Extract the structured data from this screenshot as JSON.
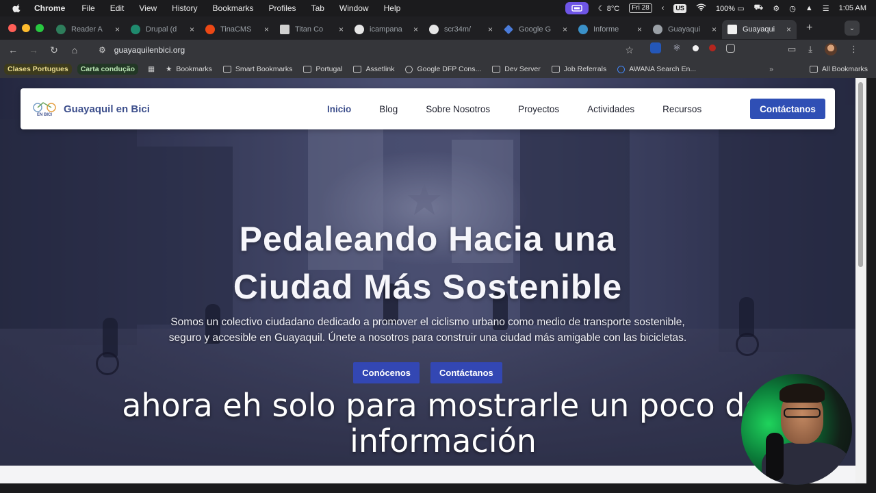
{
  "menubar": {
    "app": "Chrome",
    "items": [
      "File",
      "Edit",
      "View",
      "History",
      "Bookmarks",
      "Profiles",
      "Tab",
      "Window",
      "Help"
    ],
    "weather": "8°C",
    "date": "Fri 28",
    "input_source": "US",
    "battery": "100%",
    "time": "1:05 AM"
  },
  "tabs": [
    {
      "label": "Reader A",
      "color": "#2e7d5b"
    },
    {
      "label": "Drupal (d",
      "color": "#1f8a6e"
    },
    {
      "label": "TinaCMS",
      "color": "#ec4815"
    },
    {
      "label": "Titan Co",
      "color": "#d0d0d0"
    },
    {
      "label": "icampana",
      "color": "#e6e6e6"
    },
    {
      "label": "scr34m/",
      "color": "#e6e6e6"
    },
    {
      "label": "Google G",
      "color": "#4a7bd9"
    },
    {
      "label": "Informe",
      "color": "#3a91c9"
    },
    {
      "label": "Guayaqui",
      "color": "#9aa0a6"
    },
    {
      "label": "Guayaqui",
      "color": "#f0f0f0"
    }
  ],
  "omnibox": {
    "url": "guayaquilenbici.org"
  },
  "bookmarks": {
    "chips": [
      "Clases Portugues",
      "Carta condução"
    ],
    "items": [
      "Bookmarks",
      "Smart Bookmarks",
      "Portugal",
      "Assetlink",
      "Google DFP Cons...",
      "Dev Server",
      "Job Referrals",
      "AWANA Search En..."
    ],
    "more": "»",
    "all": "All Bookmarks"
  },
  "site": {
    "logo_text": "EN BICI",
    "brand": "Guayaquil en Bici",
    "nav": [
      "Inicio",
      "Blog",
      "Sobre Nosotros",
      "Proyectos",
      "Actividades",
      "Recursos"
    ],
    "cta": "Contáctanos",
    "hero_title_line1": "Pedaleando Hacia una",
    "hero_title_line2": "Ciudad Más Sostenible",
    "hero_sub_line1": "Somos un colectivo ciudadano dedicado a promover el ciclismo urbano como medio de transporte sostenible,",
    "hero_sub_line2": "seguro y accesible en Guayaquil. Únete a nosotros para construir una ciudad más amigable con las bicicletas.",
    "btn_primary": "Conócenos",
    "btn_secondary": "Contáctanos"
  },
  "caption": {
    "line1": "ahora eh solo para mostrarle un poco de",
    "line2": "información"
  },
  "colors": {
    "brand_blue": "#3d4f8c",
    "button_blue": "#2f4fb5",
    "active_tab": "#35363a"
  }
}
